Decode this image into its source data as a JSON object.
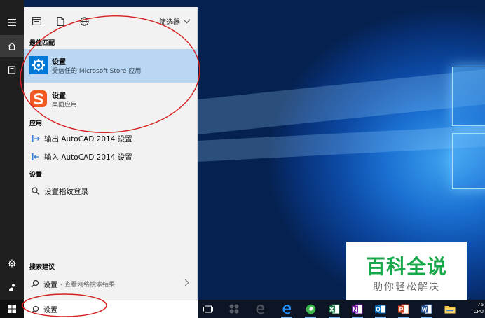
{
  "filter": {
    "label": "筛选器"
  },
  "best_match": {
    "heading": "最佳匹配",
    "items": [
      {
        "title": "设置",
        "subtitle": "受信任的 Microsoft Store 应用"
      },
      {
        "title": "设置",
        "subtitle": "桌面应用"
      }
    ]
  },
  "apps": {
    "heading": "应用",
    "items": [
      {
        "label": "输出 AutoCAD 2014 设置"
      },
      {
        "label": "输入 AutoCAD 2014 设置"
      }
    ]
  },
  "settings": {
    "heading": "设置",
    "items": [
      {
        "label": "设置指纹登录"
      }
    ]
  },
  "suggestions": {
    "heading": "搜索建议",
    "item": {
      "label": "设置",
      "hint": "- 查看网络搜索结果"
    }
  },
  "search": {
    "value": "设置"
  },
  "taskbar": {
    "apps": [
      "task-view",
      "app-grid",
      "edge-inactive",
      "edge",
      "chrome-green",
      "excel",
      "onenote",
      "outlook",
      "powerpoint",
      "word",
      "file-explorer"
    ],
    "tray": {
      "line1": "76",
      "line2": "CPU"
    }
  },
  "watermark": {
    "main": "百科全说",
    "sub": "助你轻松解决"
  },
  "colors": {
    "accent": "#0078d7",
    "selected": "#b9d6f2",
    "panel": "#f2f2f2",
    "annotation": "#d42020",
    "watermark_green": "#17a84a"
  }
}
